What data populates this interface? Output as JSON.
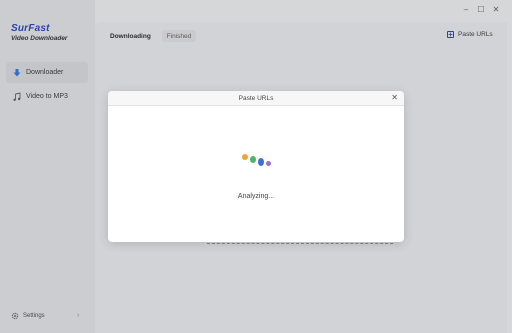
{
  "app": {
    "logo_title": "SurFast",
    "logo_subtitle": "Video Downloader"
  },
  "sidebar": {
    "items": [
      {
        "label": "Downloader",
        "icon": "download-icon",
        "active": true
      },
      {
        "label": "Video to MP3",
        "icon": "music-note-icon",
        "active": false
      }
    ],
    "settings_label": "Settings"
  },
  "window": {
    "minimize": "–",
    "maximize": "☐",
    "close": "✕"
  },
  "main": {
    "tabs": [
      {
        "label": "Downloading",
        "active": true
      },
      {
        "label": "Finished",
        "active": false
      }
    ],
    "paste_button_label": "Paste URLs"
  },
  "modal": {
    "title": "Paste URLs",
    "close_glyph": "✕",
    "status_text": "Analyzing..."
  },
  "colors": {
    "brand": "#1f3ea8",
    "loader": [
      "#f0a23a",
      "#4fb36a",
      "#3f6fd8",
      "#9a6fd0"
    ]
  }
}
